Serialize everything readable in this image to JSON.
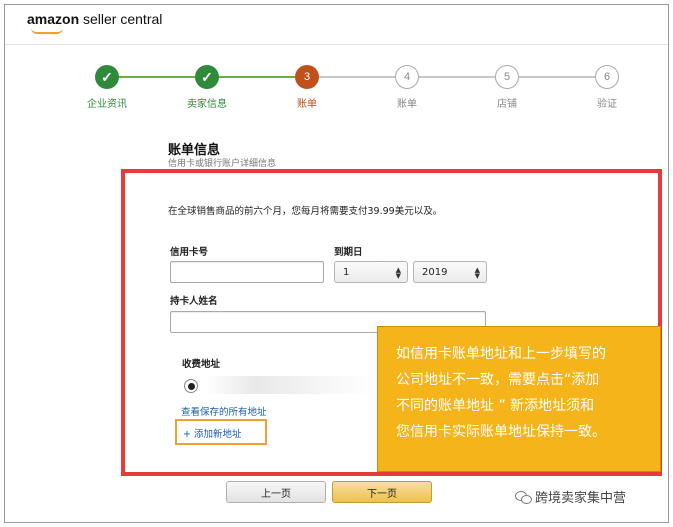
{
  "header": {
    "logo_brand": "amazon",
    "logo_rest": " seller central"
  },
  "steps": [
    {
      "label": "企业资讯",
      "status": "done",
      "mark": "✓"
    },
    {
      "label": "卖家信息",
      "status": "done",
      "mark": "✓"
    },
    {
      "label": "账单",
      "status": "active",
      "mark": "3"
    },
    {
      "label": "账单",
      "status": "todo",
      "mark": "4"
    },
    {
      "label": "店铺",
      "status": "todo",
      "mark": "5"
    },
    {
      "label": "验证",
      "status": "todo",
      "mark": "6"
    }
  ],
  "section": {
    "title": "账单信息",
    "subtitle": "信用卡或银行账户详细信息"
  },
  "form": {
    "notice": "在全球销售商品的前六个月，您每月将需要支付39.99美元以及。",
    "card_label": "信用卡号",
    "card_value": "",
    "expiry_label": "到期日",
    "month": "1",
    "year": "2019",
    "holder_label": "持卡人姓名",
    "holder_value": "",
    "address_label": "收费地址",
    "view_saved": "查看保存的所有地址",
    "add_new": "+ 添加新地址"
  },
  "callout": {
    "lines": [
      "如信用卡账单地址和上一步填写的",
      "公司地址不一致，需要点击“添加",
      "不同的账单地址 ” 新添地址须和",
      "您信用卡实际账单地址保持一致。"
    ]
  },
  "buttons": {
    "prev": "上一页",
    "next": "下一页"
  },
  "watermark": "跨境卖家集中营",
  "colors": {
    "done": "#2f8a3c",
    "active": "#c0501c",
    "highlight_border": "#e53b3b",
    "callout_bg": "#f4b41a",
    "link": "#1a5fa8",
    "next_button": "#f0c14b"
  }
}
